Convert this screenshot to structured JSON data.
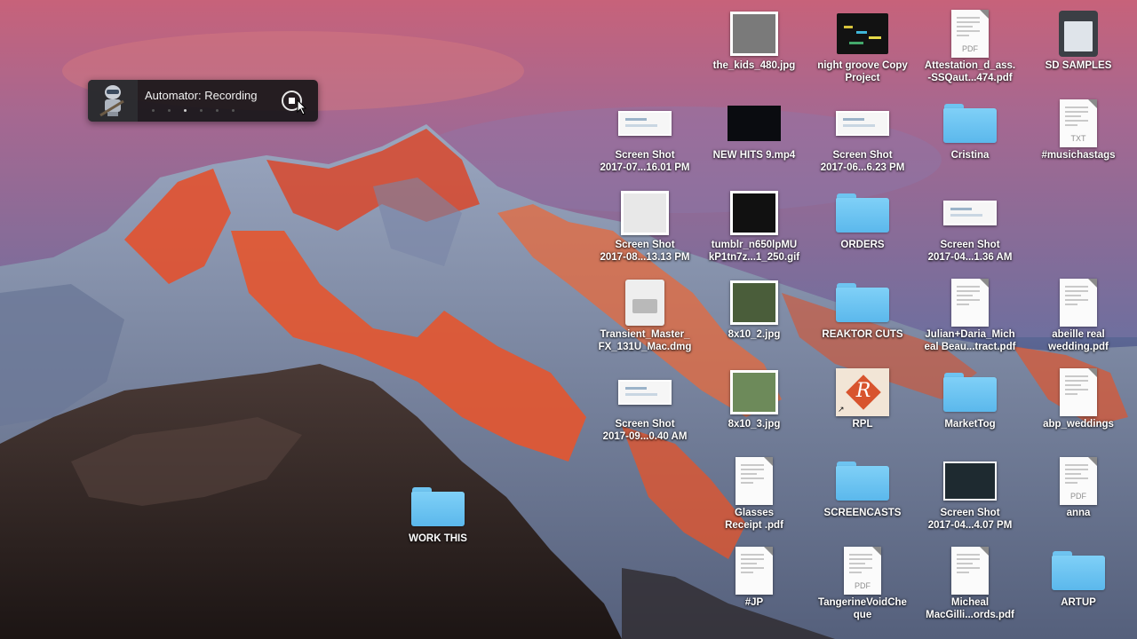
{
  "hud": {
    "title": "Automator: Recording",
    "step_total": 6,
    "step_active": 3
  },
  "icons": [
    {
      "id": "the-kids-480",
      "label": "the_kids_480.jpg",
      "kind": "photo",
      "color": "#7a7a7a"
    },
    {
      "id": "night-groove",
      "label": "night groove Copy\nProject",
      "kind": "project"
    },
    {
      "id": "attestation",
      "label": "Attestation_d_ass.\n-SSQaut...474.pdf",
      "kind": "doc",
      "ext": "PDF"
    },
    {
      "id": "sd-samples",
      "label": "SD SAMPLES",
      "kind": "sdcard"
    },
    {
      "id": "screenshot-0701",
      "label": "Screen Shot\n2017-07...16.01 PM",
      "kind": "shot"
    },
    {
      "id": "new-hits-9",
      "label": "NEW HITS 9.mp4",
      "kind": "video"
    },
    {
      "id": "screenshot-0606",
      "label": "Screen Shot\n2017-06...6.23 PM",
      "kind": "shot"
    },
    {
      "id": "cristina",
      "label": "Cristina",
      "kind": "folder"
    },
    {
      "id": "musichastags",
      "label": "#musichastags",
      "kind": "doc",
      "ext": "TXT"
    },
    {
      "id": "screenshot-0813",
      "label": "Screen Shot\n2017-08...13.13 PM",
      "kind": "photo",
      "color": "#e8e8e8"
    },
    {
      "id": "tumblr-gif",
      "label": "tumblr_n650lpMU\nkP1tn7z...1_250.gif",
      "kind": "photo",
      "color": "#111111"
    },
    {
      "id": "orders",
      "label": "ORDERS",
      "kind": "folder"
    },
    {
      "id": "screenshot-0401",
      "label": "Screen Shot\n2017-04...1.36 AM",
      "kind": "shot"
    },
    {
      "id": "transient-master",
      "label": "Transient_Master_\nFX_131U_Mac.dmg",
      "kind": "dmg"
    },
    {
      "id": "8x10-2",
      "label": "8x10_2.jpg",
      "kind": "photo",
      "color": "#4a5d3a"
    },
    {
      "id": "reaktor-cuts",
      "label": "REAKTOR CUTS",
      "kind": "folder"
    },
    {
      "id": "julian-daria",
      "label": "Julian+Daria_Mich\neal Beau...tract.pdf",
      "kind": "doc",
      "ext": ""
    },
    {
      "id": "abeille-real",
      "label": "abeille real\nwedding.pdf",
      "kind": "doc",
      "ext": ""
    },
    {
      "id": "screenshot-0909",
      "label": "Screen Shot\n2017-09...0.40 AM",
      "kind": "shot"
    },
    {
      "id": "8x10-3",
      "label": "8x10_3.jpg",
      "kind": "photo",
      "color": "#6d8a5a"
    },
    {
      "id": "rpl",
      "label": "RPL",
      "kind": "rpl",
      "glyph": "R"
    },
    {
      "id": "markettog",
      "label": "MarketTog",
      "kind": "folder"
    },
    {
      "id": "abp-weddings",
      "label": "abp_weddings",
      "kind": "doc",
      "ext": ""
    },
    {
      "id": "glasses-receipt",
      "label": "Glasses\nReceipt .pdf",
      "kind": "doc",
      "ext": ""
    },
    {
      "id": "screencasts",
      "label": "SCREENCASTS",
      "kind": "folder"
    },
    {
      "id": "screenshot-0407",
      "label": "Screen Shot\n2017-04...4.07 PM",
      "kind": "darkshot"
    },
    {
      "id": "anna",
      "label": "anna",
      "kind": "doc",
      "ext": "PDF"
    },
    {
      "id": "jp",
      "label": "#JP",
      "kind": "doc",
      "ext": ""
    },
    {
      "id": "tangerine-void",
      "label": "TangerineVoidChe\nque",
      "kind": "doc",
      "ext": "PDF"
    },
    {
      "id": "micheal-macgill",
      "label": "Micheal\nMacGilli...ords.pdf",
      "kind": "doc",
      "ext": ""
    },
    {
      "id": "artup",
      "label": "ARTUP",
      "kind": "folder"
    },
    {
      "id": "work-this",
      "label": "WORK THIS",
      "kind": "folder"
    }
  ]
}
